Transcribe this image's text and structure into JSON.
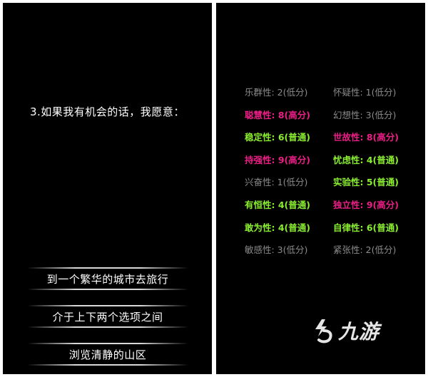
{
  "left_screen": {
    "question": "3.如果我有机会的话，我愿意：",
    "options": [
      "到一个繁华的城市去旅行",
      "介于上下两个选项之间",
      "浏览清静的山区"
    ]
  },
  "right_screen": {
    "colors": {
      "low": "#8c8c8c",
      "normal": "#8aee2f",
      "high": "#ec1e86"
    },
    "traits_left": [
      {
        "text": "乐群性: 2(低分)",
        "level": "low"
      },
      {
        "text": "聪慧性: 8(高分)",
        "level": "high"
      },
      {
        "text": "稳定性: 6(普通)",
        "level": "normal"
      },
      {
        "text": "持强性: 9(高分)",
        "level": "high"
      },
      {
        "text": "兴奋性: 1(低分)",
        "level": "low"
      },
      {
        "text": "有恒性: 4(普通)",
        "level": "normal"
      },
      {
        "text": "敢为性: 4(普通)",
        "level": "normal"
      },
      {
        "text": "敏感性: 3(低分)",
        "level": "low"
      }
    ],
    "traits_right": [
      {
        "text": "怀疑性: 1(低分)",
        "level": "low"
      },
      {
        "text": "幻想性: 3(低分)",
        "level": "low"
      },
      {
        "text": "世故性: 8(高分)",
        "level": "high"
      },
      {
        "text": "忧虑性: 4(普通)",
        "level": "normal"
      },
      {
        "text": "实验性: 5(普通)",
        "level": "normal"
      },
      {
        "text": "独立性: 9(高分)",
        "level": "high"
      },
      {
        "text": "自律性: 6(普通)",
        "level": "normal"
      },
      {
        "text": "紧张性: 2(低分)",
        "level": "low"
      }
    ],
    "watermark": {
      "icon": "jiuyou-logo-icon",
      "text": "九游"
    }
  }
}
